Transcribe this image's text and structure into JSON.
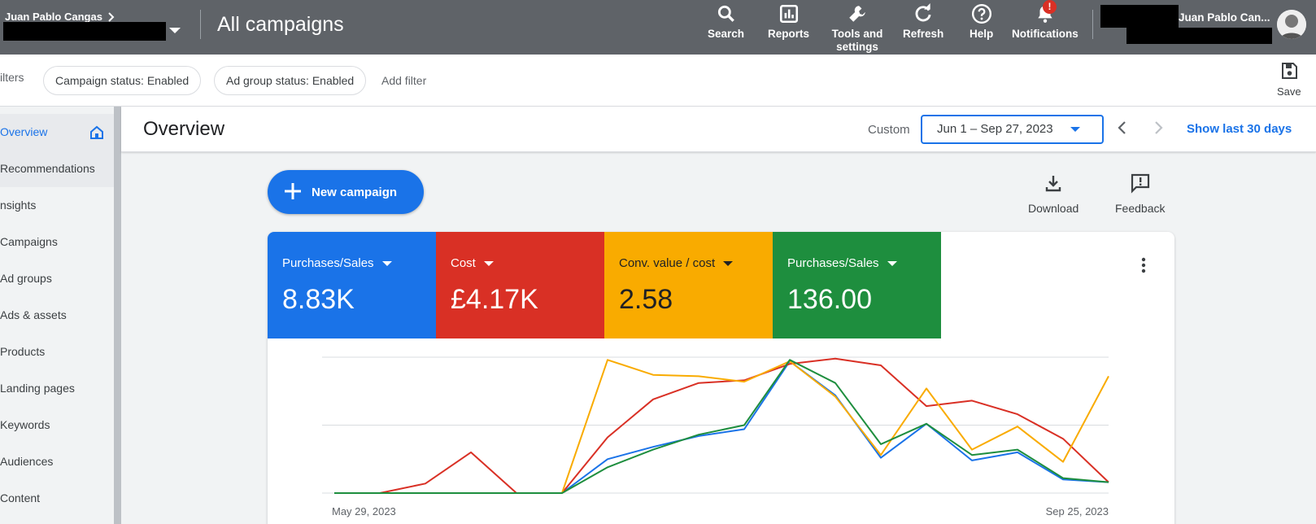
{
  "topbar": {
    "account_name": "Juan Pablo Cangas",
    "page_heading": "All campaigns",
    "nav": [
      {
        "label": "Search",
        "icon": "search-icon"
      },
      {
        "label": "Reports",
        "icon": "reports-icon"
      },
      {
        "label": "Tools and settings",
        "icon": "wrench-icon"
      },
      {
        "label": "Refresh",
        "icon": "refresh-icon"
      },
      {
        "label": "Help",
        "icon": "help-icon"
      },
      {
        "label": "Notifications",
        "icon": "bell-icon"
      }
    ],
    "notification_badge": "!",
    "user_name": "Juan Pablo Can..."
  },
  "filters": {
    "label": "ilters",
    "chips": [
      "Campaign status: Enabled",
      "Ad group status: Enabled"
    ],
    "add_filter": "Add filter",
    "save_label": "Save"
  },
  "sidebar": {
    "items": [
      {
        "label": "Overview"
      },
      {
        "label": "Recommendations"
      },
      {
        "label": "nsights"
      },
      {
        "label": "Campaigns"
      },
      {
        "label": "Ad groups"
      },
      {
        "label": "Ads & assets"
      },
      {
        "label": "Products"
      },
      {
        "label": "Landing pages"
      },
      {
        "label": "Keywords"
      },
      {
        "label": "Audiences"
      },
      {
        "label": "Content"
      }
    ]
  },
  "overview": {
    "title": "Overview",
    "custom_label": "Custom",
    "date_range": "Jun 1 – Sep 27, 2023",
    "show_last": "Show last 30 days",
    "new_campaign": "New campaign",
    "download": "Download",
    "feedback": "Feedback"
  },
  "metrics": [
    {
      "label": "Purchases/Sales",
      "value": "8.83K",
      "color": "#1a73e8"
    },
    {
      "label": "Cost",
      "value": "£4.17K",
      "color": "#d93025"
    },
    {
      "label": "Conv. value / cost",
      "value": "2.58",
      "color": "#f9ab00"
    },
    {
      "label": "Purchases/Sales",
      "value": "136.00",
      "color": "#1e8e3e"
    }
  ],
  "chart_data": {
    "type": "line",
    "x_start_label": "May 29, 2023",
    "x_end_label": "Sep 25, 2023",
    "y_normalized": true,
    "ylim": [
      0,
      1
    ],
    "grid": true,
    "series": [
      {
        "color": "#1a73e8",
        "values": [
          0,
          0,
          0,
          0,
          0,
          0,
          0.25,
          0.34,
          0.42,
          0.47,
          0.97,
          0.72,
          0.26,
          0.51,
          0.24,
          0.3,
          0.1,
          0.08
        ]
      },
      {
        "color": "#d93025",
        "values": [
          0,
          0,
          0.07,
          0.3,
          0,
          0,
          0.41,
          0.69,
          0.81,
          0.83,
          0.95,
          0.99,
          0.94,
          0.64,
          0.68,
          0.58,
          0.4,
          0.08
        ]
      },
      {
        "color": "#f9ab00",
        "values": [
          0,
          0,
          0,
          0,
          0,
          0,
          0.98,
          0.87,
          0.86,
          0.82,
          0.97,
          0.71,
          0.28,
          0.77,
          0.32,
          0.49,
          0.23,
          0.86
        ]
      },
      {
        "color": "#1e8e3e",
        "values": [
          0,
          0,
          0,
          0,
          0,
          0,
          0.19,
          0.32,
          0.43,
          0.5,
          0.98,
          0.81,
          0.36,
          0.51,
          0.28,
          0.32,
          0.11,
          0.08
        ]
      }
    ]
  }
}
